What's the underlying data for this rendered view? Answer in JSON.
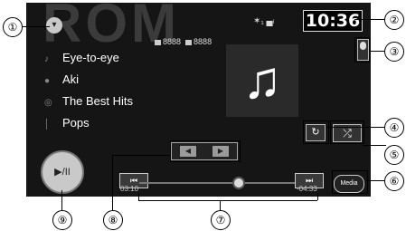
{
  "watermark": "ROM",
  "clock": "10:36",
  "status_icons": "✶₁ ▄ₗ",
  "counts": {
    "first": "8888",
    "second": "8888"
  },
  "track": [
    {
      "icon": "♪",
      "text": "Eye-to-eye"
    },
    {
      "icon": "●",
      "text": "Aki"
    },
    {
      "icon": "◎",
      "text": "The Best Hits"
    },
    {
      "icon": "│",
      "text": "Pops"
    }
  ],
  "artwork_glyph": "♫",
  "controls": {
    "folder_prev": "◀",
    "folder_next": "▶",
    "play_pause": "▶/II",
    "prev": "⏮",
    "next": "⏭",
    "elapsed": "03:10",
    "remaining": "-04:33",
    "repeat": "↻",
    "shuffle": "⤮",
    "media": "Media"
  },
  "callouts": [
    "①",
    "②",
    "③",
    "④",
    "⑤",
    "⑥",
    "⑦",
    "⑧",
    "⑨"
  ],
  "progress_fraction": 0.55
}
